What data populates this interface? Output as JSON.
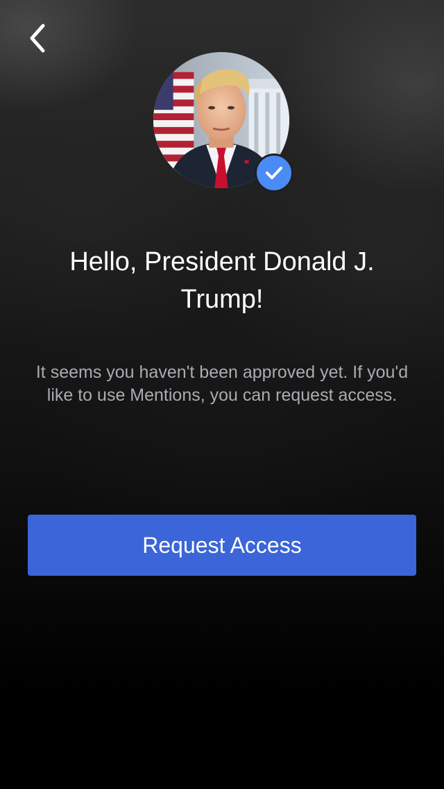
{
  "navigation": {
    "back_icon": "chevron-left-icon"
  },
  "profile": {
    "avatar_description": "profile-photo",
    "verified_icon": "checkmark-icon",
    "verified_color": "#4b8bf5"
  },
  "greeting": "Hello, President Donald J. Trump!",
  "message": "It seems you haven't been approved yet. If you'd like to use Mentions, you can request access.",
  "actions": {
    "request_label": "Request Access"
  },
  "colors": {
    "button_background": "#3b65d8",
    "message_text": "#a9acb2"
  }
}
